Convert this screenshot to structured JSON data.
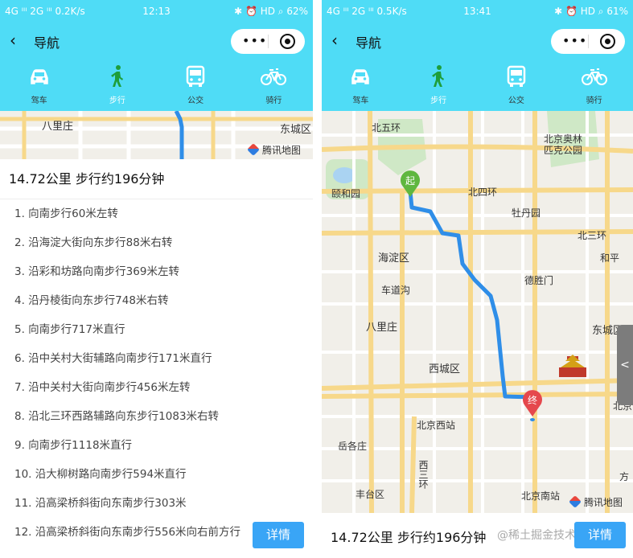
{
  "left": {
    "status": {
      "left": "4G ᴵᴵᴵ 2G ᴵᴵᴵ 0.2K/s",
      "time": "12:13",
      "right": "✱ ⏰ HD ⌕ 62%"
    },
    "nav_title": "导航",
    "modes": [
      {
        "label": "驾车",
        "icon": "car-icon"
      },
      {
        "label": "步行",
        "icon": "walk-icon"
      },
      {
        "label": "公交",
        "icon": "bus-icon"
      },
      {
        "label": "骑行",
        "icon": "bike-icon"
      }
    ],
    "map_labels": {
      "place1": "八里庄",
      "place2": "东城区",
      "brand": "腾讯地图"
    },
    "summary": "14.72公里 步行约196分钟",
    "steps": [
      "1. 向南步行60米左转",
      "2. 沿海淀大街向东步行88米右转",
      "3. 沿彩和坊路向南步行369米左转",
      "4. 沿丹棱街向东步行748米右转",
      "5. 向南步行717米直行",
      "6. 沿中关村大街辅路向南步行171米直行",
      "7. 沿中关村大街向南步行456米左转",
      "8. 沿北三环西路辅路向东步行1083米右转",
      "9. 向南步行1118米直行",
      "10. 沿大柳树路向南步行594米直行",
      "11. 沿高梁桥斜街向东南步行303米",
      "12. 沿高梁桥斜街向东南步行556米向右前方行"
    ],
    "detail_button": "详情"
  },
  "right": {
    "status": {
      "left": "4G ᴵᴵᴵ 2G ᴵᴵᴵ 0.5K/s",
      "time": "13:41",
      "right": "✱ ⏰ HD ⌕ 61%"
    },
    "nav_title": "导航",
    "modes": [
      {
        "label": "驾车",
        "icon": "car-icon"
      },
      {
        "label": "步行",
        "icon": "walk-icon"
      },
      {
        "label": "公交",
        "icon": "bus-icon"
      },
      {
        "label": "骑行",
        "icon": "bike-icon"
      }
    ],
    "map_labels": {
      "beiwuhuan": "北五环",
      "olympic": "北京奥林\n匹克公园",
      "yiheyuan": "颐和园",
      "beisihuan": "北四环",
      "mudanyuan": "牡丹园",
      "beisanhuan": "北三环",
      "haidian": "海淀区",
      "hepin": "和平",
      "chedaogou": "车道沟",
      "deshengmen": "德胜门",
      "balizhuang": "八里庄",
      "dongcheng": "东城区",
      "xicheng": "西城区",
      "beijingxizhan": "北京西站",
      "beijing": "北京",
      "yuegezhuang": "岳各庄",
      "xisanhuan": "西三环",
      "fengtai": "丰台区",
      "beijingnanzhan": "北京南站",
      "fang": "方",
      "brand": "腾讯地图"
    },
    "start_marker": "起",
    "end_marker": "终",
    "summary": "14.72公里 步行约196分钟",
    "watermark": "@稀土掘金技术社区",
    "detail_button": "详情",
    "side_handle": "<"
  },
  "colors": {
    "theme": "#4fdcf6",
    "route": "#2f8ee8",
    "button": "#39a5f6",
    "active_mode": "#1e9e3a"
  }
}
